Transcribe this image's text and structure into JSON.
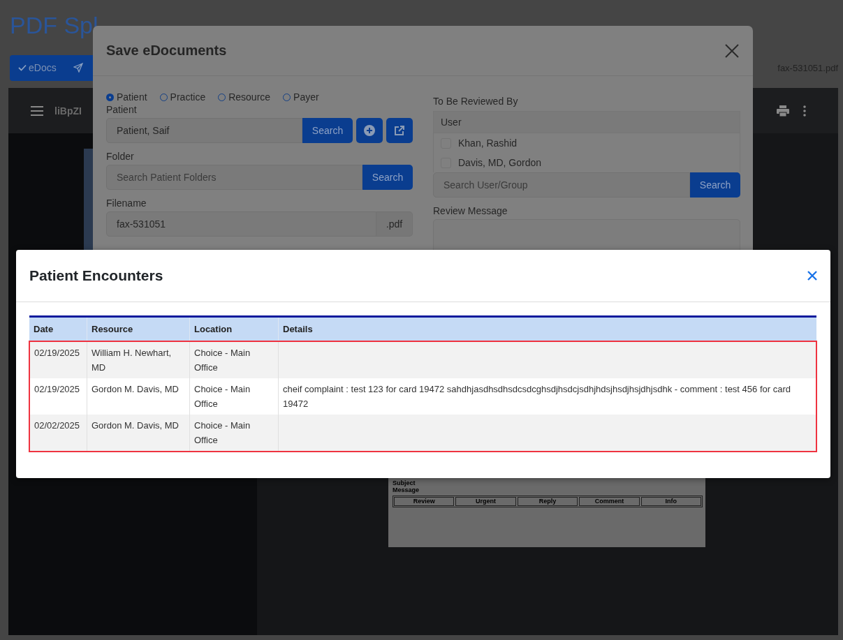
{
  "app_title": "PDF Spl",
  "toolbar": {
    "edocs_button": "eDocs",
    "filename": "fax-531051.pdf"
  },
  "viewer": {
    "doc_title": "liBpZI",
    "page": {
      "labels": [
        "Subject",
        "Message"
      ],
      "buttons": [
        "Review",
        "Urgent",
        "Reply",
        "Comment",
        "Info"
      ]
    }
  },
  "save_dialog": {
    "title": "Save eDocuments",
    "entity_types": [
      {
        "label": "Patient",
        "selected": true
      },
      {
        "label": "Practice",
        "selected": false
      },
      {
        "label": "Resource",
        "selected": false
      },
      {
        "label": "Payer",
        "selected": false
      }
    ],
    "patient": {
      "label": "Patient",
      "value": "Patient, Saif",
      "button": "Search"
    },
    "folder": {
      "label": "Folder",
      "placeholder": "Search Patient Folders",
      "button": "Search"
    },
    "filename": {
      "label": "Filename",
      "value": "fax-531051",
      "extension": ".pdf"
    },
    "reviewers": {
      "label": "To Be Reviewed By",
      "column": "User",
      "users": [
        {
          "name": "Khan, Rashid",
          "checked": false
        },
        {
          "name": "Davis, MD, Gordon",
          "checked": false
        }
      ],
      "placeholder": "Search User/Group",
      "button": "Search"
    },
    "review_message": {
      "label": "Review Message"
    }
  },
  "encounters_dialog": {
    "title": "Patient Encounters",
    "columns": [
      "Date",
      "Resource",
      "Location",
      "Details"
    ],
    "rows": [
      {
        "cells": [
          "02/19/2025",
          "William H. Newhart, MD",
          "Choice - Main Office",
          ""
        ]
      },
      {
        "cells": [
          "02/19/2025",
          "Gordon M. Davis, MD",
          "Choice - Main Office",
          "cheif complaint : test 123 for card 19472 sahdhjasdhsdhsdcsdcghsdjhsdcjsdhjhdsjhsdjhsjdhjsdhk - comment : test 456 for card 19472"
        ]
      },
      {
        "cells": [
          "02/02/2025",
          "Gordon M. Davis, MD",
          "Choice - Main Office",
          ""
        ]
      }
    ]
  }
}
